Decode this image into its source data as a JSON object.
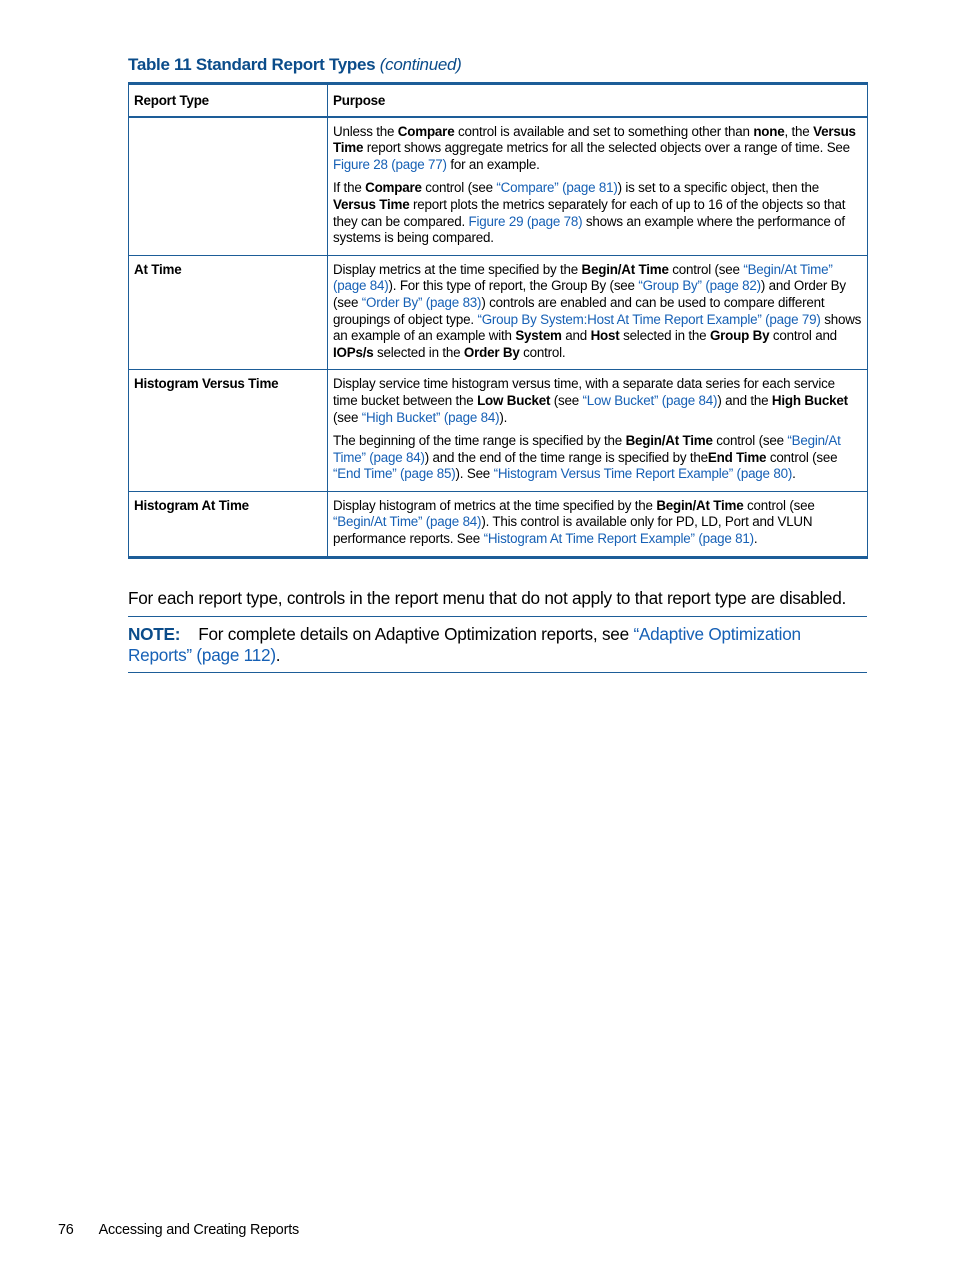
{
  "caption": {
    "title": "Table 11 Standard Report Types",
    "continued": "(continued)"
  },
  "table": {
    "headers": [
      "Report Type",
      "Purpose"
    ],
    "rows": [
      {
        "type": "",
        "paragraphs": [
          [
            {
              "t": "Unless the "
            },
            {
              "t": "Compare",
              "b": true
            },
            {
              "t": " control is available and set to something other than "
            },
            {
              "t": "none",
              "b": true
            },
            {
              "t": ", the "
            },
            {
              "t": "Versus Time",
              "b": true
            },
            {
              "t": " report shows aggregate metrics for all the selected objects over a range of time. See "
            },
            {
              "t": "Figure 28 (page 77)",
              "link": true
            },
            {
              "t": " for an example."
            }
          ],
          [
            {
              "t": "If the "
            },
            {
              "t": "Compare",
              "b": true
            },
            {
              "t": " control (see "
            },
            {
              "t": "“Compare” (page 81)",
              "link": true
            },
            {
              "t": ") is set to a specific object, then the "
            },
            {
              "t": "Versus Time",
              "b": true
            },
            {
              "t": " report plots the metrics separately for each of up to 16 of the objects so that they can be compared. "
            },
            {
              "t": "Figure 29 (page 78)",
              "link": true
            },
            {
              "t": " shows an example where the performance of systems is being compared."
            }
          ]
        ]
      },
      {
        "type": "At Time",
        "paragraphs": [
          [
            {
              "t": "Display metrics at the time specified by the "
            },
            {
              "t": "Begin/At Time",
              "b": true
            },
            {
              "t": " control (see "
            },
            {
              "t": "“Begin/At Time” (page 84)",
              "link": true
            },
            {
              "t": "). For this type of report, the Group By (see "
            },
            {
              "t": "“Group By” (page 82)",
              "link": true
            },
            {
              "t": ") and Order By (see "
            },
            {
              "t": "“Order By” (page 83)",
              "link": true
            },
            {
              "t": ") controls are enabled and can be used to compare different groupings of object type. "
            },
            {
              "t": "“Group By System:Host At Time Report Example” (page 79)",
              "link": true
            },
            {
              "t": " shows an example of an example with "
            },
            {
              "t": "System",
              "b": true
            },
            {
              "t": " and "
            },
            {
              "t": "Host",
              "b": true
            },
            {
              "t": " selected in the "
            },
            {
              "t": "Group By",
              "b": true
            },
            {
              "t": " control and "
            },
            {
              "t": "IOPs/s",
              "b": true
            },
            {
              "t": " selected in the "
            },
            {
              "t": "Order By",
              "b": true
            },
            {
              "t": " control."
            }
          ]
        ]
      },
      {
        "type": "Histogram Versus Time",
        "paragraphs": [
          [
            {
              "t": "Display service time histogram versus time, with a separate data series for each service time bucket between the "
            },
            {
              "t": "Low Bucket",
              "b": true
            },
            {
              "t": " (see "
            },
            {
              "t": "“Low Bucket” (page 84)",
              "link": true
            },
            {
              "t": ") and the "
            },
            {
              "t": "High Bucket",
              "b": true
            },
            {
              "t": " (see "
            },
            {
              "t": "“High Bucket” (page 84)",
              "link": true
            },
            {
              "t": ")."
            }
          ],
          [
            {
              "t": "The beginning of the time range is specified by the "
            },
            {
              "t": "Begin/At Time",
              "b": true
            },
            {
              "t": " control (see "
            },
            {
              "t": "“Begin/At Time” (page 84)",
              "link": true
            },
            {
              "t": ") and the end of the time range is specified by the"
            },
            {
              "t": "End Time",
              "b": true
            },
            {
              "t": " control (see "
            },
            {
              "t": "“End Time” (page 85)",
              "link": true
            },
            {
              "t": "). See "
            },
            {
              "t": "“Histogram Versus Time Report Example” (page 80)",
              "link": true
            },
            {
              "t": "."
            }
          ]
        ]
      },
      {
        "type": "Histogram At Time",
        "paragraphs": [
          [
            {
              "t": "Display histogram of metrics at the time specified by the "
            },
            {
              "t": "Begin/At Time",
              "b": true
            },
            {
              "t": " control (see "
            },
            {
              "t": "“Begin/At Time” (page 84)",
              "link": true
            },
            {
              "t": "). This control is available only for PD, LD, Port and VLUN performance reports. See "
            },
            {
              "t": "“Histogram At Time Report Example” (page 81)",
              "link": true
            },
            {
              "t": "."
            }
          ]
        ]
      }
    ]
  },
  "body_text": "For each report type, controls in the report menu that do not apply to that report type are disabled.",
  "note": {
    "label": "NOTE:",
    "text": "For complete details on Adaptive Optimization reports, see ",
    "link": "“Adaptive Optimization Reports” (page 112)",
    "end": "."
  },
  "footer": {
    "page_number": "76",
    "section": "Accessing and Creating Reports"
  },
  "colors": {
    "accent": "#0b4c8a",
    "link": "#1660b5",
    "rule": "#1d5d98"
  }
}
